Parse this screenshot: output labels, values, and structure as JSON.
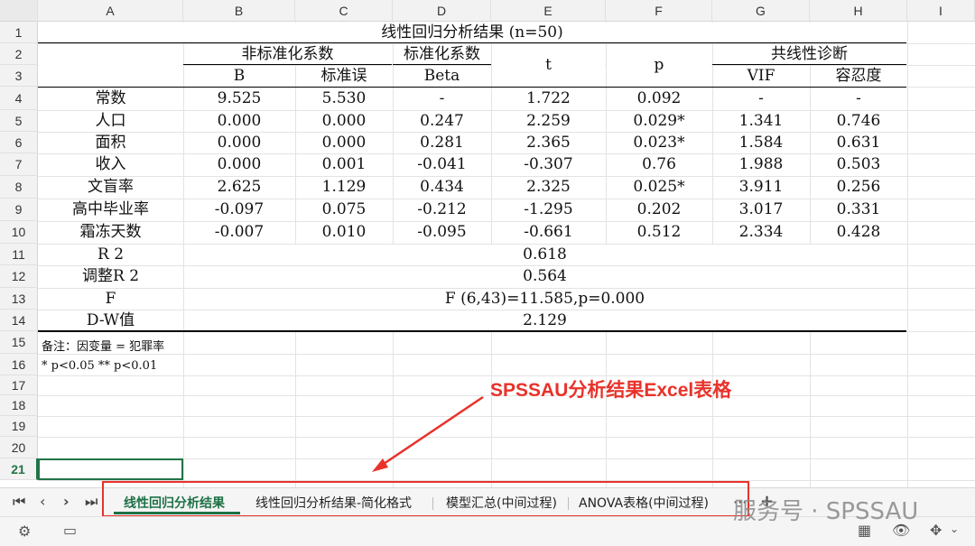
{
  "columns": [
    "A",
    "B",
    "C",
    "D",
    "E",
    "F",
    "G",
    "H",
    "I"
  ],
  "rows": [
    "1",
    "2",
    "3",
    "4",
    "5",
    "6",
    "7",
    "8",
    "9",
    "10",
    "11",
    "12",
    "13",
    "14",
    "15",
    "16",
    "17",
    "18",
    "19",
    "20",
    "21"
  ],
  "table": {
    "title": "线性回归分析结果 (n=50)",
    "group_unstd": "非标准化系数",
    "group_std": "标准化系数",
    "group_col": "共线性诊断",
    "h_B": "B",
    "h_se": "标准误",
    "h_beta": "Beta",
    "h_t": "t",
    "h_p": "p",
    "h_vif": "VIF",
    "h_tol": "容忍度",
    "data_rows": [
      [
        "常数",
        "9.525",
        "5.530",
        "-",
        "1.722",
        "0.092",
        "-",
        "-"
      ],
      [
        "人口",
        "0.000",
        "0.000",
        "0.247",
        "2.259",
        "0.029*",
        "1.341",
        "0.746"
      ],
      [
        "面积",
        "0.000",
        "0.000",
        "0.281",
        "2.365",
        "0.023*",
        "1.584",
        "0.631"
      ],
      [
        "收入",
        "0.000",
        "0.001",
        "-0.041",
        "-0.307",
        "0.76",
        "1.988",
        "0.503"
      ],
      [
        "文盲率",
        "2.625",
        "1.129",
        "0.434",
        "2.325",
        "0.025*",
        "3.911",
        "0.256"
      ],
      [
        "高中毕业率",
        "-0.097",
        "0.075",
        "-0.212",
        "-1.295",
        "0.202",
        "3.017",
        "0.331"
      ],
      [
        "霜冻天数",
        "-0.007",
        "0.010",
        "-0.095",
        "-0.661",
        "0.512",
        "2.334",
        "0.428"
      ]
    ],
    "r2_label": "R 2",
    "r2_value": "0.618",
    "adj_label": "调整R 2",
    "adj_value": "0.564",
    "f_label": "F",
    "f_value": "F (6,43)=11.585,p=0.000",
    "dw_label": "D-W值",
    "dw_value": "2.129",
    "note1": "备注：因变量 = 犯罪率",
    "note2": "* p<0.05 ** p<0.01"
  },
  "annotation": "SPSSAU分析结果Excel表格",
  "tabs": [
    "线性回归分析结果",
    "线性回归分析结果-简化格式",
    "模型汇总(中间过程)",
    "ANOVA表格(中间过程)"
  ],
  "active_tab": "线性回归分析结果",
  "nav": {
    "first": "|<",
    "prev": "<",
    "next": ">",
    "last": ">|",
    "more": "···",
    "add": "+"
  },
  "watermark": "服务号 · SPSSAU",
  "colors": {
    "accent": "#217346",
    "annotation": "#e8322a"
  }
}
